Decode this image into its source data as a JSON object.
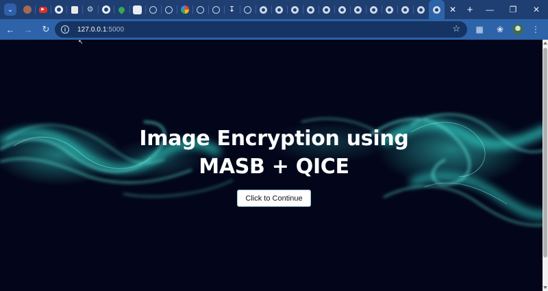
{
  "browser": {
    "tabs": [
      {
        "icon": "avatar-icon",
        "active": false
      },
      {
        "icon": "youtube-icon",
        "active": false
      },
      {
        "icon": "github-icon",
        "active": false
      },
      {
        "icon": "document-icon",
        "active": false
      },
      {
        "icon": "gear-icon",
        "active": false
      },
      {
        "icon": "github-icon",
        "active": false
      },
      {
        "icon": "maps-icon",
        "active": false
      },
      {
        "icon": "blank-page-icon",
        "active": false
      },
      {
        "icon": "globe-icon",
        "active": false
      },
      {
        "icon": "globe-icon",
        "active": false
      },
      {
        "icon": "google-icon",
        "active": false
      },
      {
        "icon": "globe-icon",
        "active": false
      },
      {
        "icon": "globe-icon",
        "active": false
      },
      {
        "icon": "download-icon",
        "active": false
      },
      {
        "icon": "globe-icon",
        "active": false
      },
      {
        "icon": "chrome-icon",
        "active": false
      },
      {
        "icon": "chrome-icon",
        "active": false
      },
      {
        "icon": "chrome-icon",
        "active": false
      },
      {
        "icon": "chrome-icon",
        "active": false
      },
      {
        "icon": "chrome-icon",
        "active": false
      },
      {
        "icon": "chrome-icon",
        "active": false
      },
      {
        "icon": "chrome-icon",
        "active": false
      },
      {
        "icon": "chrome-icon",
        "active": false
      },
      {
        "icon": "chrome-icon",
        "active": false
      },
      {
        "icon": "chrome-icon",
        "active": false
      },
      {
        "icon": "chrome-icon",
        "active": false
      },
      {
        "icon": "chrome-icon",
        "active": true
      }
    ],
    "address": {
      "host": "127.0.0.1",
      "port": ":5000"
    },
    "colors": {
      "tabstrip": "#1f3f73",
      "toolbar": "#2d63a9",
      "omnibox": "#163463"
    }
  },
  "page": {
    "title_line1": "Image Encryption using",
    "title_line2": "MASB + QICE",
    "continue_label": "Click to Continue",
    "colors": {
      "background": "#03061a",
      "smoke": "#2fc9c0",
      "button_bg": "#ffffff"
    }
  }
}
